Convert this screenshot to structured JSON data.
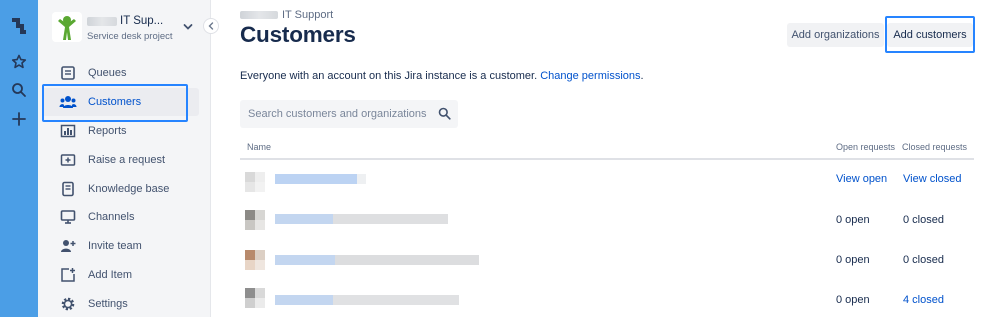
{
  "colors": {
    "global_nav": "#4b9ee6",
    "sidebar_bg": "#f4f5f7",
    "link": "#0052cc",
    "highlight": "#2684ff",
    "text": "#172b4d"
  },
  "global_nav": {
    "icons": [
      "jira-logo-icon",
      "star-icon",
      "search-icon",
      "plus-icon"
    ]
  },
  "project": {
    "name": "IT Sup...",
    "type": "Service desk project"
  },
  "sidebar": {
    "items": [
      {
        "label": "Queues",
        "icon": "queues-icon"
      },
      {
        "label": "Customers",
        "icon": "customers-icon",
        "active": true
      },
      {
        "label": "Reports",
        "icon": "reports-icon"
      },
      {
        "label": "Raise a request",
        "icon": "raise-request-icon"
      },
      {
        "label": "Knowledge base",
        "icon": "knowledge-base-icon"
      },
      {
        "label": "Channels",
        "icon": "channels-icon"
      },
      {
        "label": "Invite team",
        "icon": "invite-team-icon"
      },
      {
        "label": "Add Item",
        "icon": "add-item-icon"
      },
      {
        "label": "Settings",
        "icon": "settings-icon"
      }
    ]
  },
  "breadcrumb": {
    "project": "IT Support"
  },
  "page": {
    "title": "Customers",
    "description": "Everyone with an account on this Jira instance is a customer.",
    "change_permissions": "Change permissions",
    "period": "."
  },
  "toolbar": {
    "add_organizations": "Add organizations",
    "add_customers": "Add customers"
  },
  "search": {
    "placeholder": "Search customers and organizations"
  },
  "table": {
    "headers": {
      "name": "Name",
      "open": "Open requests",
      "closed": "Closed requests"
    },
    "rows": [
      {
        "open": "View open",
        "closed": "View closed",
        "open_link": true,
        "closed_link": true
      },
      {
        "open": "0 open",
        "closed": "0 closed",
        "open_link": false,
        "closed_link": false
      },
      {
        "open": "0 open",
        "closed": "0 closed",
        "open_link": false,
        "closed_link": false
      },
      {
        "open": "0 open",
        "closed": "4 closed",
        "open_link": false,
        "closed_link": true
      }
    ]
  }
}
